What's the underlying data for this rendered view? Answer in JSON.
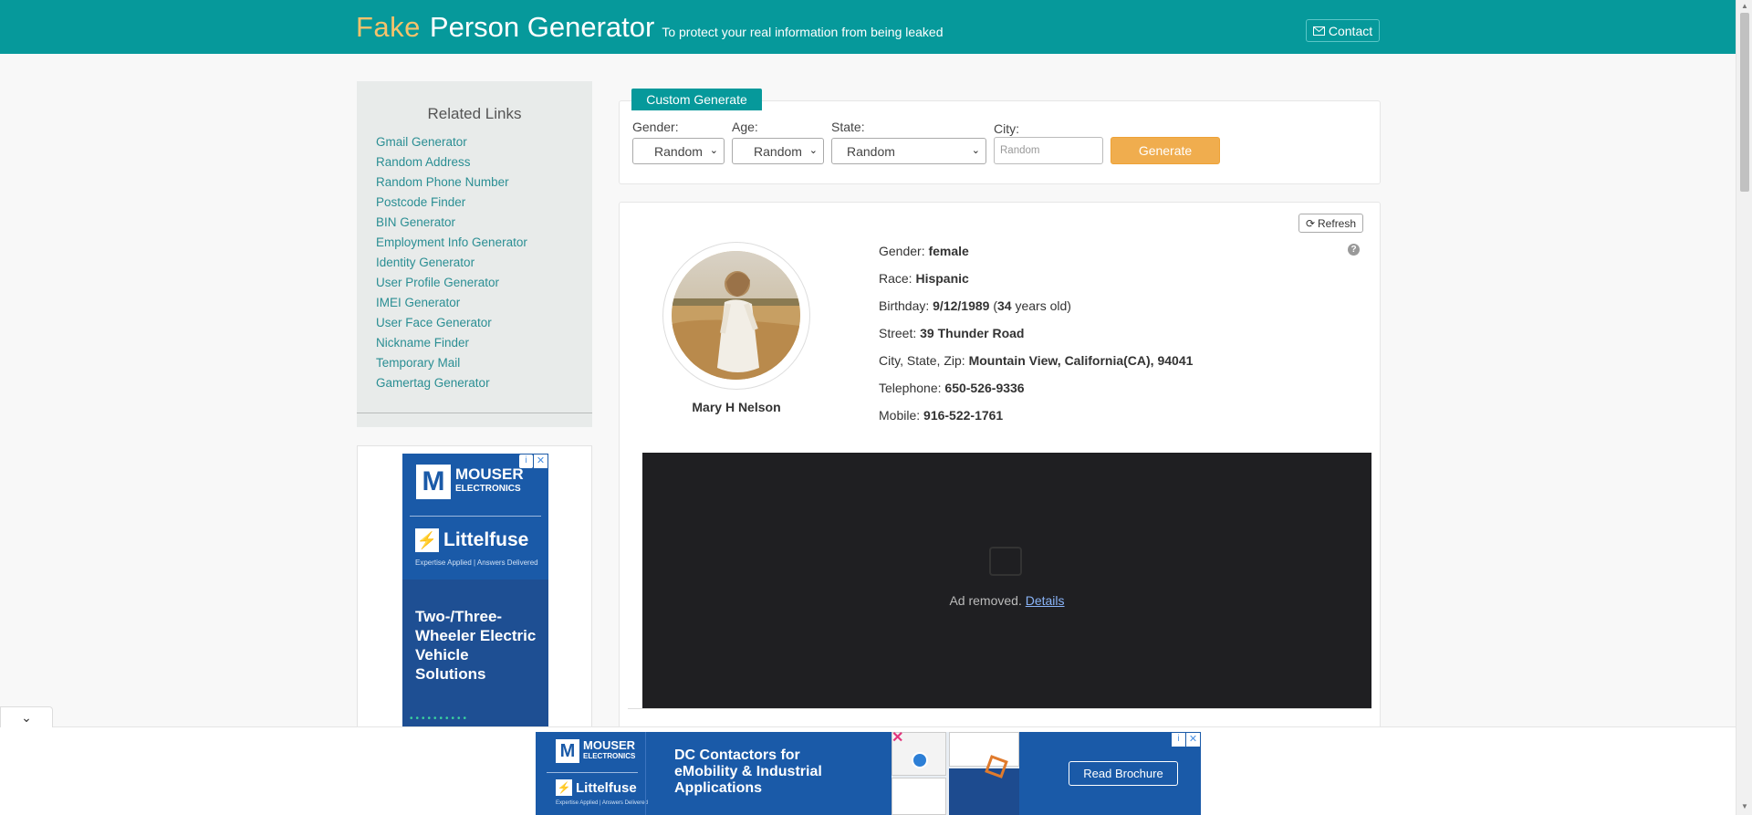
{
  "header": {
    "brand_fake": "Fake",
    "brand_rest": "Person Generator",
    "tagline": "To protect your real information from being leaked",
    "contact_label": "Contact"
  },
  "sidebar": {
    "title": "Related Links",
    "links": [
      "Gmail Generator",
      "Random Address",
      "Random Phone Number",
      "Postcode Finder",
      "BIN Generator",
      "Employment Info Generator",
      "Identity Generator",
      "User Profile Generator",
      "IMEI Generator",
      "User Face Generator",
      "Nickname Finder",
      "Temporary Mail",
      "Gamertag Generator"
    ]
  },
  "side_ad": {
    "brand": "MOUSER",
    "brand_sub": "ELECTRONICS",
    "partner": "Littelfuse",
    "partner_sub": "Expertise Applied | Answers Delivered",
    "headline": "Two-/Three-Wheeler Electric Vehicle Solutions"
  },
  "form": {
    "tab_label": "Custom Generate",
    "gender_label": "Gender:",
    "gender_value": "Random",
    "age_label": "Age:",
    "age_value": "Random",
    "state_label": "State:",
    "state_value": "Random",
    "city_label": "City:",
    "city_placeholder": "Random",
    "generate_label": "Generate"
  },
  "result": {
    "refresh_label": "Refresh",
    "name": "Mary H Nelson",
    "gender_label": "Gender:",
    "gender": "female",
    "race_label": "Race:",
    "race": "Hispanic",
    "birthday_label": "Birthday:",
    "birthday": "9/12/1989",
    "age": "34",
    "age_suffix": "years old)",
    "street_label": "Street:",
    "street": "39 Thunder Road",
    "city_label": "City, State, Zip:",
    "city": "Mountain View, California(CA), 94041",
    "telephone_label": "Telephone:",
    "telephone": "650-526-9336",
    "mobile_label": "Mobile:",
    "mobile": "916-522-1761"
  },
  "ad_removed": {
    "text": "Ad removed.",
    "link": "Details"
  },
  "bottom_ad": {
    "brand": "MOUSER",
    "brand_sub": "ELECTRONICS",
    "partner": "Littelfuse",
    "partner_sub": "Expertise Applied | Answers Delivered",
    "headline": "DC Contactors for eMobility & Industrial Applications",
    "cta": "Read Brochure"
  }
}
